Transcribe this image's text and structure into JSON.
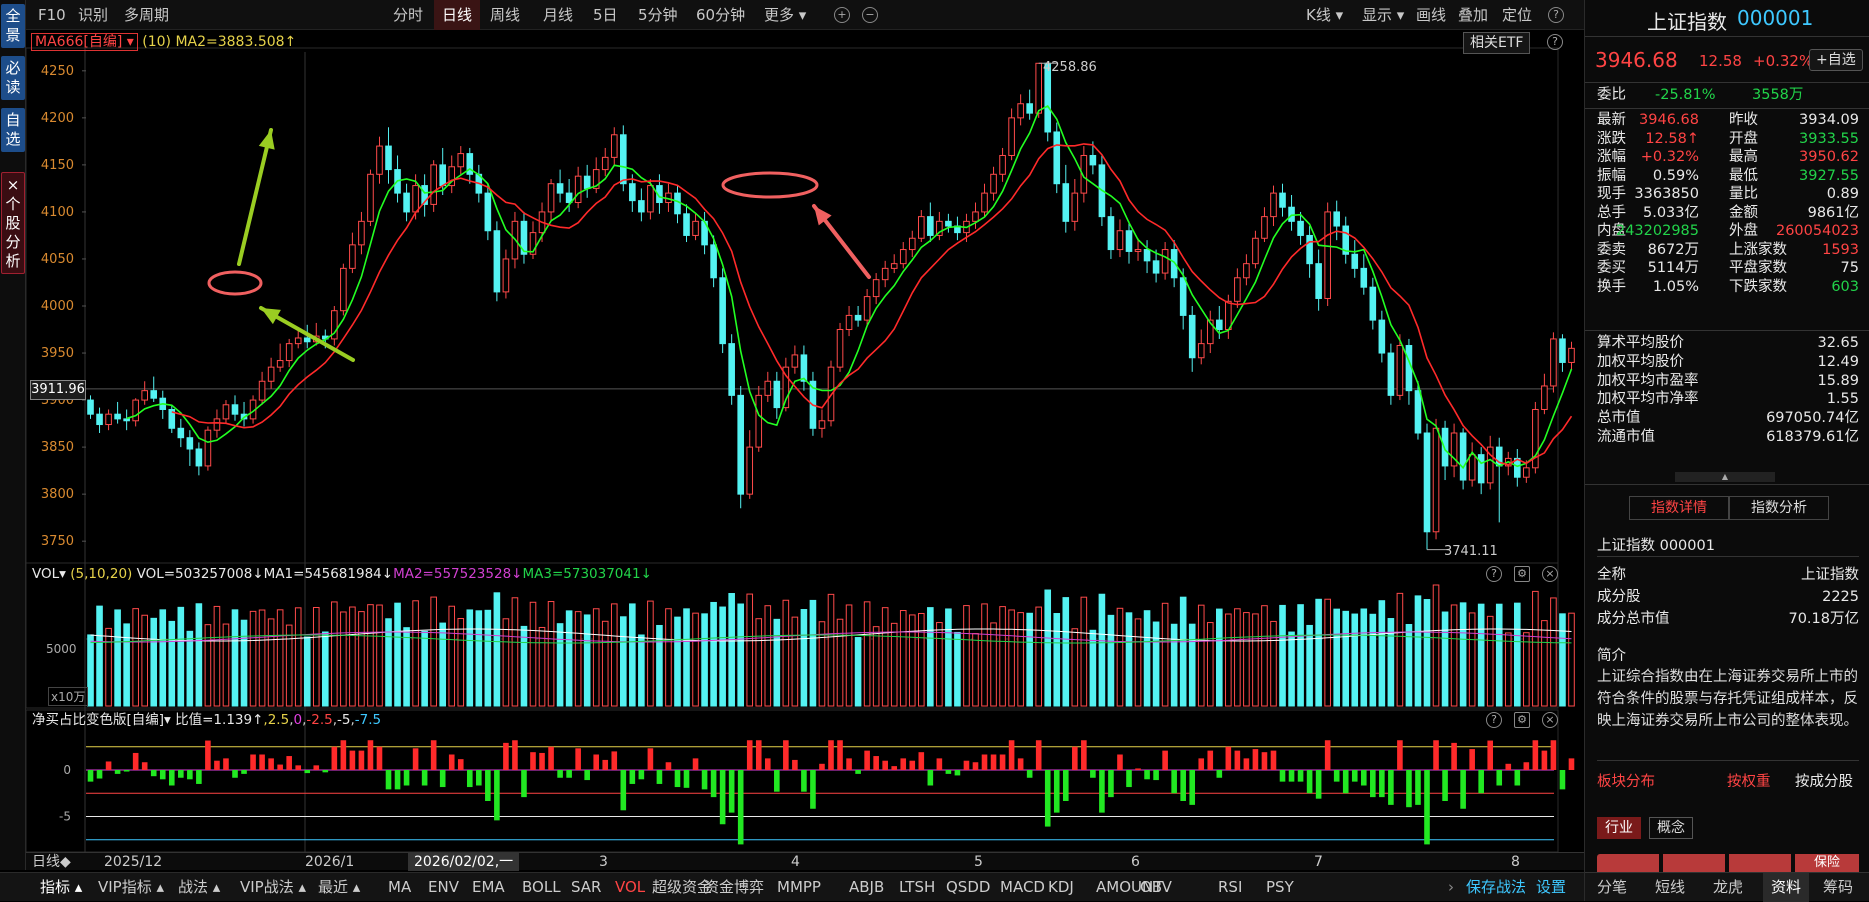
{
  "left_tabs": [
    "全景",
    "必读",
    "自选",
    "个股分析"
  ],
  "left_tab_close": "×",
  "toolbar": {
    "f10": "F10",
    "shibie": "识别",
    "duozhouqi": "多周期",
    "periods": [
      "分时",
      "日线",
      "周线",
      "月线",
      "5日",
      "5分钟",
      "60分钟",
      "更多"
    ],
    "active_period": "日线",
    "right": [
      "K线",
      "显示",
      "画线",
      "叠加",
      "定位"
    ]
  },
  "main_chart": {
    "ma_box": "MA666[自编]",
    "ma_param": "(10)",
    "ma_value": "MA2=3883.508↑",
    "etf_button": "相关ETF",
    "current_price_label": "3911.96",
    "high_label": "4258.86",
    "low_label": "3741.11"
  },
  "vol_panel": {
    "label": "VOL",
    "params": "(5,10,20)",
    "vol": "VOL=503257008↓",
    "ma1": "MA1=545681984↓",
    "ma2": "MA2=557523528↓",
    "ma3": "MA3=573037041↓",
    "unit": "x10万",
    "tick": "5000"
  },
  "net_panel": {
    "label": "净买占比变色版[自编]",
    "ratio": "比值=1.139↑",
    "p1": "2.5",
    "p2": "0",
    "p3": "-2.5",
    "p4": "-5",
    "p5": "-7.5"
  },
  "date_axis": {
    "period": "日线",
    "cursor": "2026/02/02,一",
    "labels": [
      "2025/12",
      "2026/1",
      "3",
      "4",
      "5",
      "6",
      "7",
      "8"
    ]
  },
  "chart_data": {
    "type": "candlestick",
    "title": "上证指数 000001 日线",
    "ylim": [
      3730,
      4270
    ],
    "yticks": [
      3750,
      3800,
      3850,
      3900,
      3950,
      4000,
      4050,
      4100,
      4150,
      4200,
      4250
    ],
    "series": [
      {
        "name": "candles",
        "values": [
          [
            3900,
            3885,
            3905,
            3880
          ],
          [
            3885,
            3874,
            3892,
            3865
          ],
          [
            3874,
            3885,
            3890,
            3868
          ],
          [
            3885,
            3880,
            3898,
            3875
          ],
          [
            3880,
            3878,
            3890,
            3868
          ],
          [
            3878,
            3900,
            3902,
            3872
          ],
          [
            3900,
            3910,
            3920,
            3895
          ],
          [
            3910,
            3902,
            3925,
            3898
          ],
          [
            3902,
            3890,
            3910,
            3880
          ],
          [
            3890,
            3870,
            3895,
            3865
          ],
          [
            3870,
            3860,
            3880,
            3850
          ],
          [
            3860,
            3848,
            3868,
            3830
          ],
          [
            3848,
            3830,
            3855,
            3820
          ],
          [
            3830,
            3868,
            3872,
            3825
          ],
          [
            3868,
            3880,
            3890,
            3860
          ],
          [
            3880,
            3895,
            3900,
            3875
          ],
          [
            3895,
            3885,
            3905,
            3878
          ],
          [
            3885,
            3880,
            3898,
            3872
          ],
          [
            3880,
            3900,
            3905,
            3875
          ],
          [
            3900,
            3920,
            3930,
            3895
          ],
          [
            3920,
            3935,
            3945,
            3912
          ],
          [
            3935,
            3942,
            3960,
            3930
          ],
          [
            3942,
            3960,
            3965,
            3935
          ],
          [
            3960,
            3966,
            3976,
            3955
          ],
          [
            3966,
            3962,
            3980,
            3955
          ],
          [
            3962,
            3968,
            3982,
            3958
          ],
          [
            3968,
            3965,
            3975,
            3955
          ],
          [
            3965,
            3995,
            4000,
            3958
          ],
          [
            3995,
            4040,
            4045,
            3990
          ],
          [
            4040,
            4065,
            4078,
            4035
          ],
          [
            4065,
            4090,
            4100,
            4055
          ],
          [
            4090,
            4140,
            4145,
            4085
          ],
          [
            4140,
            4170,
            4180,
            4130
          ],
          [
            4170,
            4145,
            4190,
            4130
          ],
          [
            4145,
            4120,
            4160,
            4110
          ],
          [
            4120,
            4100,
            4130,
            4090
          ],
          [
            4100,
            4128,
            4140,
            4092
          ],
          [
            4128,
            4108,
            4140,
            4095
          ],
          [
            4108,
            4150,
            4155,
            4100
          ],
          [
            4150,
            4128,
            4168,
            4118
          ],
          [
            4128,
            4148,
            4160,
            4120
          ],
          [
            4148,
            4162,
            4170,
            4140
          ],
          [
            4162,
            4140,
            4168,
            4130
          ],
          [
            4140,
            4120,
            4150,
            4110
          ],
          [
            4120,
            4080,
            4130,
            4070
          ],
          [
            4080,
            4015,
            4090,
            4005
          ],
          [
            4015,
            4050,
            4060,
            4008
          ],
          [
            4050,
            4090,
            4100,
            4040
          ],
          [
            4090,
            4055,
            4100,
            4045
          ],
          [
            4055,
            4078,
            4090,
            4050
          ],
          [
            4078,
            4100,
            4110,
            4068
          ],
          [
            4100,
            4130,
            4135,
            4090
          ],
          [
            4130,
            4120,
            4145,
            4110
          ],
          [
            4120,
            4110,
            4135,
            4100
          ],
          [
            4110,
            4138,
            4148,
            4104
          ],
          [
            4138,
            4125,
            4150,
            4115
          ],
          [
            4125,
            4145,
            4158,
            4120
          ],
          [
            4145,
            4158,
            4168,
            4138
          ],
          [
            4158,
            4182,
            4190,
            4150
          ],
          [
            4182,
            4130,
            4192,
            4122
          ],
          [
            4130,
            4112,
            4140,
            4100
          ],
          [
            4112,
            4100,
            4125,
            4090
          ],
          [
            4100,
            4128,
            4135,
            4092
          ],
          [
            4128,
            4110,
            4140,
            4098
          ],
          [
            4110,
            4120,
            4130,
            4100
          ],
          [
            4120,
            4098,
            4128,
            4088
          ],
          [
            4098,
            4075,
            4108,
            4068
          ],
          [
            4075,
            4090,
            4098,
            4070
          ],
          [
            4090,
            4065,
            4100,
            4055
          ],
          [
            4065,
            4030,
            4075,
            4020
          ],
          [
            4030,
            3960,
            4040,
            3950
          ],
          [
            3960,
            3905,
            3970,
            3895
          ],
          [
            3905,
            3800,
            3915,
            3785
          ],
          [
            3800,
            3850,
            3868,
            3795
          ],
          [
            3850,
            3905,
            3915,
            3845
          ],
          [
            3905,
            3920,
            3930,
            3898
          ],
          [
            3920,
            3892,
            3930,
            3880
          ],
          [
            3892,
            3935,
            3945,
            3888
          ],
          [
            3935,
            3948,
            3958,
            3928
          ],
          [
            3948,
            3920,
            3958,
            3910
          ],
          [
            3920,
            3870,
            3930,
            3862
          ],
          [
            3870,
            3878,
            3890,
            3860
          ],
          [
            3878,
            3935,
            3942,
            3872
          ],
          [
            3935,
            3975,
            3982,
            3930
          ],
          [
            3975,
            3990,
            4000,
            3968
          ],
          [
            3990,
            3985,
            4000,
            3978
          ],
          [
            3985,
            4010,
            4018,
            3980
          ],
          [
            4010,
            4028,
            4035,
            4002
          ],
          [
            4028,
            4040,
            4048,
            4020
          ],
          [
            4040,
            4045,
            4055,
            4035
          ],
          [
            4045,
            4060,
            4068,
            4040
          ],
          [
            4060,
            4072,
            4080,
            4052
          ],
          [
            4072,
            4095,
            4102,
            4068
          ],
          [
            4095,
            4075,
            4110,
            4068
          ],
          [
            4075,
            4090,
            4100,
            4070
          ],
          [
            4090,
            4085,
            4098,
            4078
          ],
          [
            4085,
            4078,
            4095,
            4070
          ],
          [
            4078,
            4090,
            4098,
            4068
          ],
          [
            4090,
            4100,
            4110,
            4082
          ],
          [
            4100,
            4120,
            4130,
            4095
          ],
          [
            4120,
            4140,
            4148,
            4112
          ],
          [
            4140,
            4160,
            4168,
            4132
          ],
          [
            4160,
            4200,
            4210,
            4155
          ],
          [
            4200,
            4215,
            4225,
            4192
          ],
          [
            4215,
            4205,
            4230,
            4198
          ],
          [
            4205,
            4258,
            4258,
            4200
          ],
          [
            4258,
            4185,
            4258,
            4175
          ],
          [
            4185,
            4130,
            4195,
            4120
          ],
          [
            4130,
            4090,
            4150,
            4078
          ],
          [
            4090,
            4120,
            4135,
            4080
          ],
          [
            4120,
            4160,
            4170,
            4110
          ],
          [
            4160,
            4150,
            4175,
            4140
          ],
          [
            4150,
            4095,
            4160,
            4085
          ],
          [
            4095,
            4060,
            4105,
            4050
          ],
          [
            4060,
            4080,
            4092,
            4052
          ],
          [
            4080,
            4058,
            4090,
            4045
          ],
          [
            4058,
            4060,
            4072,
            4048
          ],
          [
            4060,
            4048,
            4070,
            4035
          ],
          [
            4048,
            4035,
            4060,
            4025
          ],
          [
            4035,
            4060,
            4068,
            4028
          ],
          [
            4060,
            4030,
            4070,
            4020
          ],
          [
            4030,
            3990,
            4040,
            3975
          ],
          [
            3990,
            3945,
            4000,
            3930
          ],
          [
            3945,
            3960,
            3975,
            3938
          ],
          [
            3960,
            3985,
            3995,
            3950
          ],
          [
            3985,
            3975,
            4000,
            3965
          ],
          [
            3975,
            4005,
            4012,
            3965
          ],
          [
            4005,
            4030,
            4040,
            3998
          ],
          [
            4030,
            4045,
            4055,
            4022
          ],
          [
            4045,
            4072,
            4080,
            4040
          ],
          [
            4072,
            4095,
            4105,
            4068
          ],
          [
            4095,
            4120,
            4128,
            4085
          ],
          [
            4120,
            4105,
            4130,
            4095
          ],
          [
            4105,
            4090,
            4118,
            4080
          ],
          [
            4090,
            4075,
            4100,
            4065
          ],
          [
            4075,
            4045,
            4085,
            4030
          ],
          [
            4045,
            4008,
            4060,
            3995
          ],
          [
            4008,
            4100,
            4110,
            4000
          ],
          [
            4100,
            4085,
            4112,
            4070
          ],
          [
            4085,
            4055,
            4095,
            4045
          ],
          [
            4055,
            4040,
            4070,
            4030
          ],
          [
            4040,
            4020,
            4055,
            4012
          ],
          [
            4020,
            3985,
            4030,
            3975
          ],
          [
            3985,
            3950,
            3995,
            3940
          ],
          [
            3950,
            3905,
            3960,
            3895
          ],
          [
            3905,
            3958,
            3970,
            3900
          ],
          [
            3958,
            3910,
            3965,
            3895
          ],
          [
            3910,
            3865,
            3920,
            3858
          ],
          [
            3865,
            3760,
            3875,
            3741
          ],
          [
            3760,
            3870,
            3880,
            3752
          ],
          [
            3870,
            3830,
            3878,
            3815
          ],
          [
            3830,
            3865,
            3875,
            3818
          ],
          [
            3865,
            3815,
            3870,
            3805
          ],
          [
            3815,
            3842,
            3855,
            3808
          ],
          [
            3842,
            3812,
            3850,
            3800
          ],
          [
            3812,
            3850,
            3862,
            3805
          ],
          [
            3850,
            3830,
            3860,
            3770
          ],
          [
            3830,
            3838,
            3845,
            3820
          ],
          [
            3838,
            3818,
            3848,
            3808
          ],
          [
            3818,
            3828,
            3836,
            3812
          ],
          [
            3828,
            3890,
            3898,
            3822
          ],
          [
            3890,
            3915,
            3928,
            3885
          ],
          [
            3915,
            3965,
            3972,
            3908
          ],
          [
            3965,
            3940,
            3970,
            3930
          ],
          [
            3940,
            3955,
            3962,
            3932
          ]
        ]
      },
      {
        "name": "MA(short)",
        "color": "#22ff22"
      },
      {
        "name": "MA2",
        "color": "#ff2a2a"
      }
    ]
  },
  "annotations": {
    "ellipses": 2,
    "arrows": 4
  },
  "bottom_tabs": [
    "指标",
    "VIP指标",
    "战法",
    "VIP战法",
    "最近",
    "MA",
    "ENV",
    "EMA",
    "BOLL",
    "SAR",
    "VOL",
    "超级资金",
    "资金博弈",
    "MMPP",
    "ABJB",
    "LTSH",
    "QSDD",
    "MACD",
    "KDJ",
    "AMOUNT",
    "OBV",
    "RSI",
    "PSY",
    "保存战法",
    "设置"
  ],
  "right": {
    "name": "上证指数",
    "code": "000001",
    "price": "3946.68",
    "change": "12.58",
    "pct": "+0.32%",
    "add_btn": "+自选",
    "weibi_label": "委比",
    "weibi": "-25.81%",
    "weibi_vol": "3558万",
    "rows": [
      [
        "最新",
        "3946.68",
        "昨收",
        "3934.09"
      ],
      [
        "涨跌",
        "12.58↑",
        "开盘",
        "3933.55"
      ],
      [
        "涨幅",
        "+0.32%",
        "最高",
        "3950.62"
      ],
      [
        "振幅",
        "0.59%",
        "最低",
        "3927.55"
      ],
      [
        "现手",
        "3363850",
        "量比",
        "0.89"
      ],
      [
        "总手",
        "5.033亿",
        "金额",
        "9861亿"
      ],
      [
        "内盘",
        "243202985",
        "外盘",
        "260054023"
      ],
      [
        "委卖",
        "8672万",
        "上涨家数",
        "1593"
      ],
      [
        "委买",
        "5114万",
        "平盘家数",
        "75"
      ],
      [
        "换手",
        "1.05%",
        "下跌家数",
        "603"
      ]
    ],
    "stats": [
      [
        "算术平均股价",
        "32.65"
      ],
      [
        "加权平均股价",
        "12.49"
      ],
      [
        "加权平均市盈率",
        "15.89"
      ],
      [
        "加权平均市净率",
        "1.55"
      ],
      [
        "总市值",
        "697050.74亿"
      ],
      [
        "流通市值",
        "618379.61亿"
      ]
    ],
    "tabs": [
      "指数详情",
      "指数分析"
    ],
    "idx_name": "上证指数",
    "idx_code": "000001",
    "detail": [
      [
        "全称",
        "上证指数"
      ],
      [
        "成分股",
        "2225"
      ],
      [
        "成分总市值",
        "70.18万亿"
      ]
    ],
    "intro_title": "简介",
    "intro": "上证综合指数由在上海证券交易所上市的符合条件的股票与存托凭证组成样本，反映上海证券交易所上市公司的整体表现。",
    "sector_title": "板块分布",
    "sector_a": "按权重",
    "sector_b": "按成分股",
    "chips": [
      "行业",
      "概念"
    ],
    "heat": [
      "保险"
    ],
    "bottom_tabs": [
      "分笔",
      "短线",
      "龙虎",
      "资料",
      "筹码"
    ],
    "active_bottom": "资料"
  }
}
